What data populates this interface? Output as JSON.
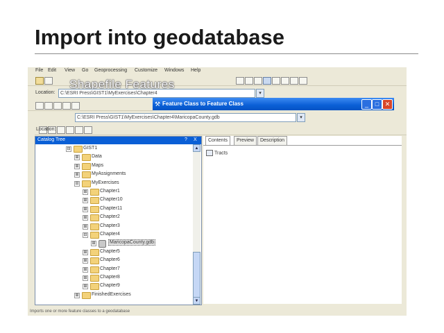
{
  "slide": {
    "title": "Import into geodatabase"
  },
  "screenshot": {
    "menu": [
      "File",
      "Edit",
      "View",
      "Go",
      "Geoprocessing",
      "Customize",
      "Windows",
      "Help"
    ],
    "overlay_text": "Shapefile Features",
    "location_top": {
      "label": "Location:",
      "value": "C:\\ESRI Press\\GIST1\\MyExercises\\Chapter4"
    },
    "location_second": {
      "label": "Location:",
      "value": "C:\\ESRI Press\\GIST1\\MyExercises\\Chapter4\\MaricopaCounty.gdb"
    },
    "dialog": {
      "title": "Feature Class to Feature Class"
    },
    "catalog": {
      "title": "Catalog Tree",
      "header_buttons": [
        "?",
        "X"
      ],
      "items": [
        {
          "label": "GIST1",
          "expander": "⊟"
        },
        {
          "label": "Data",
          "expander": "⊞"
        },
        {
          "label": "Maps",
          "expander": "⊞"
        },
        {
          "label": "MyAssignments",
          "expander": "⊞"
        },
        {
          "label": "MyExercises",
          "expander": "⊟"
        },
        {
          "label": "Chapter1",
          "expander": "⊞"
        },
        {
          "label": "Chapter10",
          "expander": "⊞"
        },
        {
          "label": "Chapter11",
          "expander": "⊞"
        },
        {
          "label": "Chapter2",
          "expander": "⊞"
        },
        {
          "label": "Chapter3",
          "expander": "⊞"
        },
        {
          "label": "Chapter4",
          "expander": "⊟"
        },
        {
          "label": "MaricopaCounty.gdb",
          "expander": "⊞"
        },
        {
          "label": "Chapter5",
          "expander": "⊞"
        },
        {
          "label": "Chapter6",
          "expander": "⊞"
        },
        {
          "label": "Chapter7",
          "expander": "⊞"
        },
        {
          "label": "Chapter8",
          "expander": "⊞"
        },
        {
          "label": "Chapter9",
          "expander": "⊞"
        },
        {
          "label": "FinishedExercises",
          "expander": "⊞"
        }
      ]
    },
    "tabs": [
      "Contents",
      "Preview",
      "Description"
    ],
    "contents": [
      "Tracts"
    ],
    "status": "Imports one or more feature classes to a geodatabase"
  }
}
